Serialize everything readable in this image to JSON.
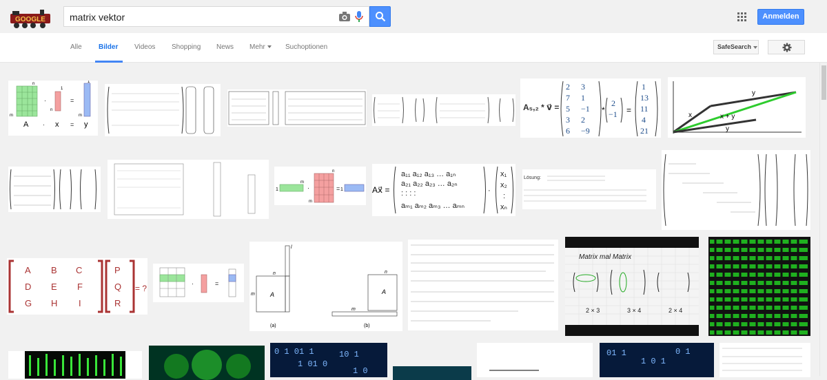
{
  "header": {
    "logo_text": "GOOGLE",
    "search_value": "matrix vektor",
    "signin_label": "Anmelden",
    "brand_blue": "#4d90fe",
    "icons": [
      "camera-icon",
      "microphone-icon",
      "search-icon",
      "apps-grid-icon"
    ]
  },
  "nav": {
    "tabs": [
      "Alle",
      "Bilder",
      "Videos",
      "Shopping",
      "News",
      "Mehr"
    ],
    "active_tab": "Bilder",
    "tools_label": "Suchoptionen",
    "safesearch_label": "SafeSearch",
    "settings_icon": "gear-icon"
  },
  "thumbs": {
    "t1": {
      "m": "m",
      "n": "n",
      "one": "1",
      "A": "A",
      "x": "x",
      "y": "y",
      "dot": "·",
      "eq": "="
    },
    "t5": {
      "lhs": "A₅,₂ * v⃗ =",
      "col1": [
        "2",
        "7",
        "5",
        "3",
        "6"
      ],
      "col2": [
        "3",
        "1",
        "−1",
        "2",
        "−9"
      ],
      "vec": [
        "2",
        "−1"
      ],
      "res": [
        "1",
        "13",
        "11",
        "4",
        "21"
      ],
      "star": "*",
      "eq": "="
    },
    "t6": {
      "x": "x",
      "y": "y",
      "xy": "x + y"
    },
    "t9": {
      "lhs": "Ax⃗ =",
      "row1": "a₁₁  a₁₂  a₁₃ …  a₁ₙ",
      "row2": "a₂₁  a₂₂  a₂₃ …  a₂ₙ",
      "row3": ":     :     :        :",
      "row4": "aₘ₁  aₘ₂  aₘ₃ …  aₘₙ",
      "vec": [
        "x₁",
        "x₂",
        ":",
        "xₙ"
      ],
      "dot": "·"
    },
    "t10": {
      "label": "Lösung:"
    },
    "t12": {
      "letters": [
        "A",
        "B",
        "C",
        "D",
        "E",
        "F",
        "G",
        "H",
        "I"
      ],
      "right": [
        "P",
        "Q",
        "R"
      ],
      "tail": "= ?"
    },
    "t14": {
      "A": "A",
      "n": "n",
      "m": "m",
      "l": "l",
      "cap_a": "(a)",
      "cap_b": "(b)"
    },
    "t16": {
      "title": "Matrix mal Matrix",
      "d1": "2 × 3",
      "d2": "3 × 4",
      "d3": "2 × 4"
    }
  }
}
